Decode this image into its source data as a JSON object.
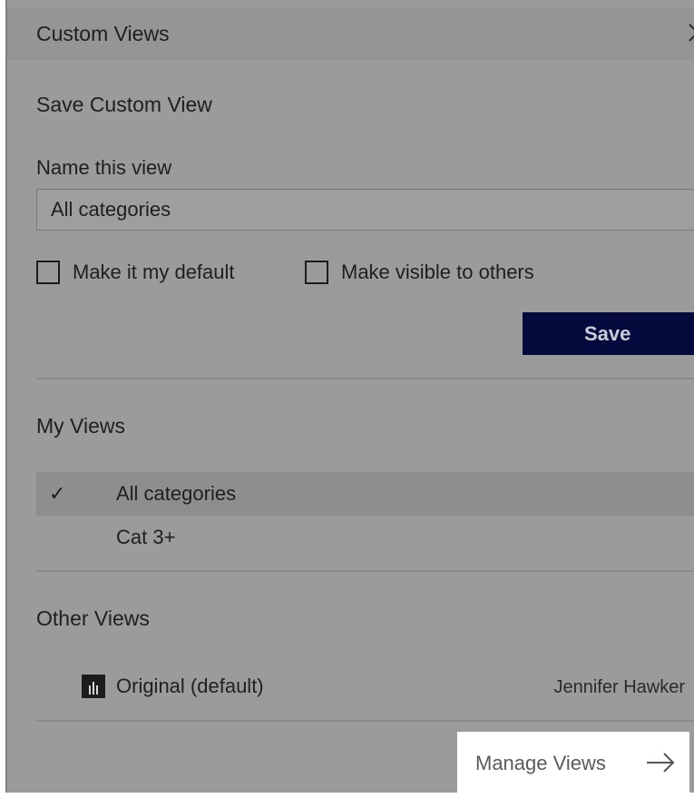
{
  "panel": {
    "title": "Custom Views"
  },
  "save_section": {
    "title": "Save Custom View",
    "name_label": "Name this view",
    "name_value": "All categories",
    "default_checkbox_label": "Make it my default",
    "default_checked": false,
    "visible_checkbox_label": "Make visible to others",
    "visible_checked": false,
    "save_label": "Save"
  },
  "my_views": {
    "title": "My Views",
    "items": [
      {
        "label": "All categories",
        "selected": true,
        "check": "✓"
      },
      {
        "label": "Cat 3+",
        "selected": false
      }
    ]
  },
  "other_views": {
    "title": "Other Views",
    "items": [
      {
        "label": "Original (default)",
        "owner": "Jennifer Hawker",
        "icon": "view-thumbnail-icon"
      }
    ]
  },
  "footer": {
    "manage_label": "Manage Views",
    "icon": "arrow-right-icon"
  },
  "colors": {
    "overlay": "#9b9b9b",
    "save_button": "#040a3c",
    "selected_row": "#8e8e8e",
    "highlight": "#ffffff"
  }
}
